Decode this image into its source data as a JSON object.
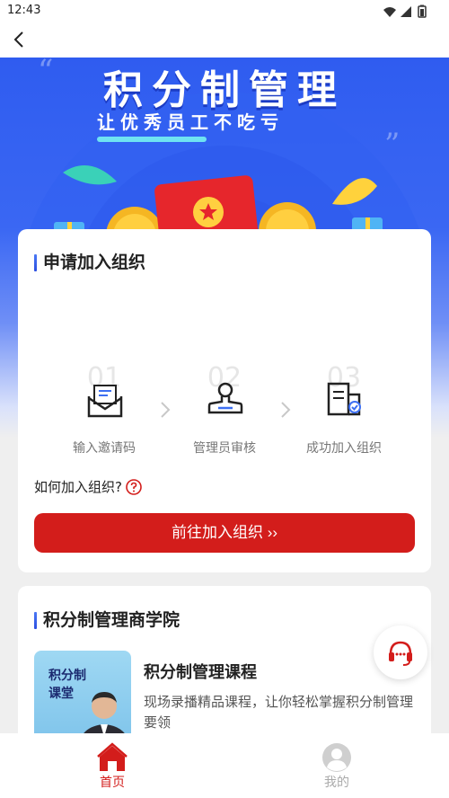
{
  "status_bar": {
    "time": "12:43"
  },
  "banner": {
    "title": "积分制管理",
    "subtitle": "让优秀员工不吃亏"
  },
  "join_card": {
    "title": "申请加入组织",
    "steps": [
      {
        "num": "01",
        "label": "输入邀请码",
        "icon": "envelope-icon"
      },
      {
        "num": "02",
        "label": "管理员审核",
        "icon": "stamp-icon"
      },
      {
        "num": "03",
        "label": "成功加入组织",
        "icon": "document-check-icon"
      }
    ],
    "how_to": "如何加入组织?",
    "button_label": "前往加入组织 ››"
  },
  "academy_card": {
    "title": "积分制管理商学院",
    "course": {
      "thumb_text_line1": "积分制",
      "thumb_text_line2": "课堂",
      "title": "积分制管理课程",
      "description": "现场录播精品课程，让你轻松掌握积分制管理要领"
    }
  },
  "tabbar": {
    "tabs": [
      {
        "label": "首页",
        "active": true,
        "icon": "home-icon"
      },
      {
        "label": "我的",
        "active": false,
        "icon": "user-icon"
      }
    ]
  },
  "colors": {
    "accent": "#d31d1b",
    "banner_blue": "#3a67f3",
    "inactive": "#aaaaaa"
  }
}
